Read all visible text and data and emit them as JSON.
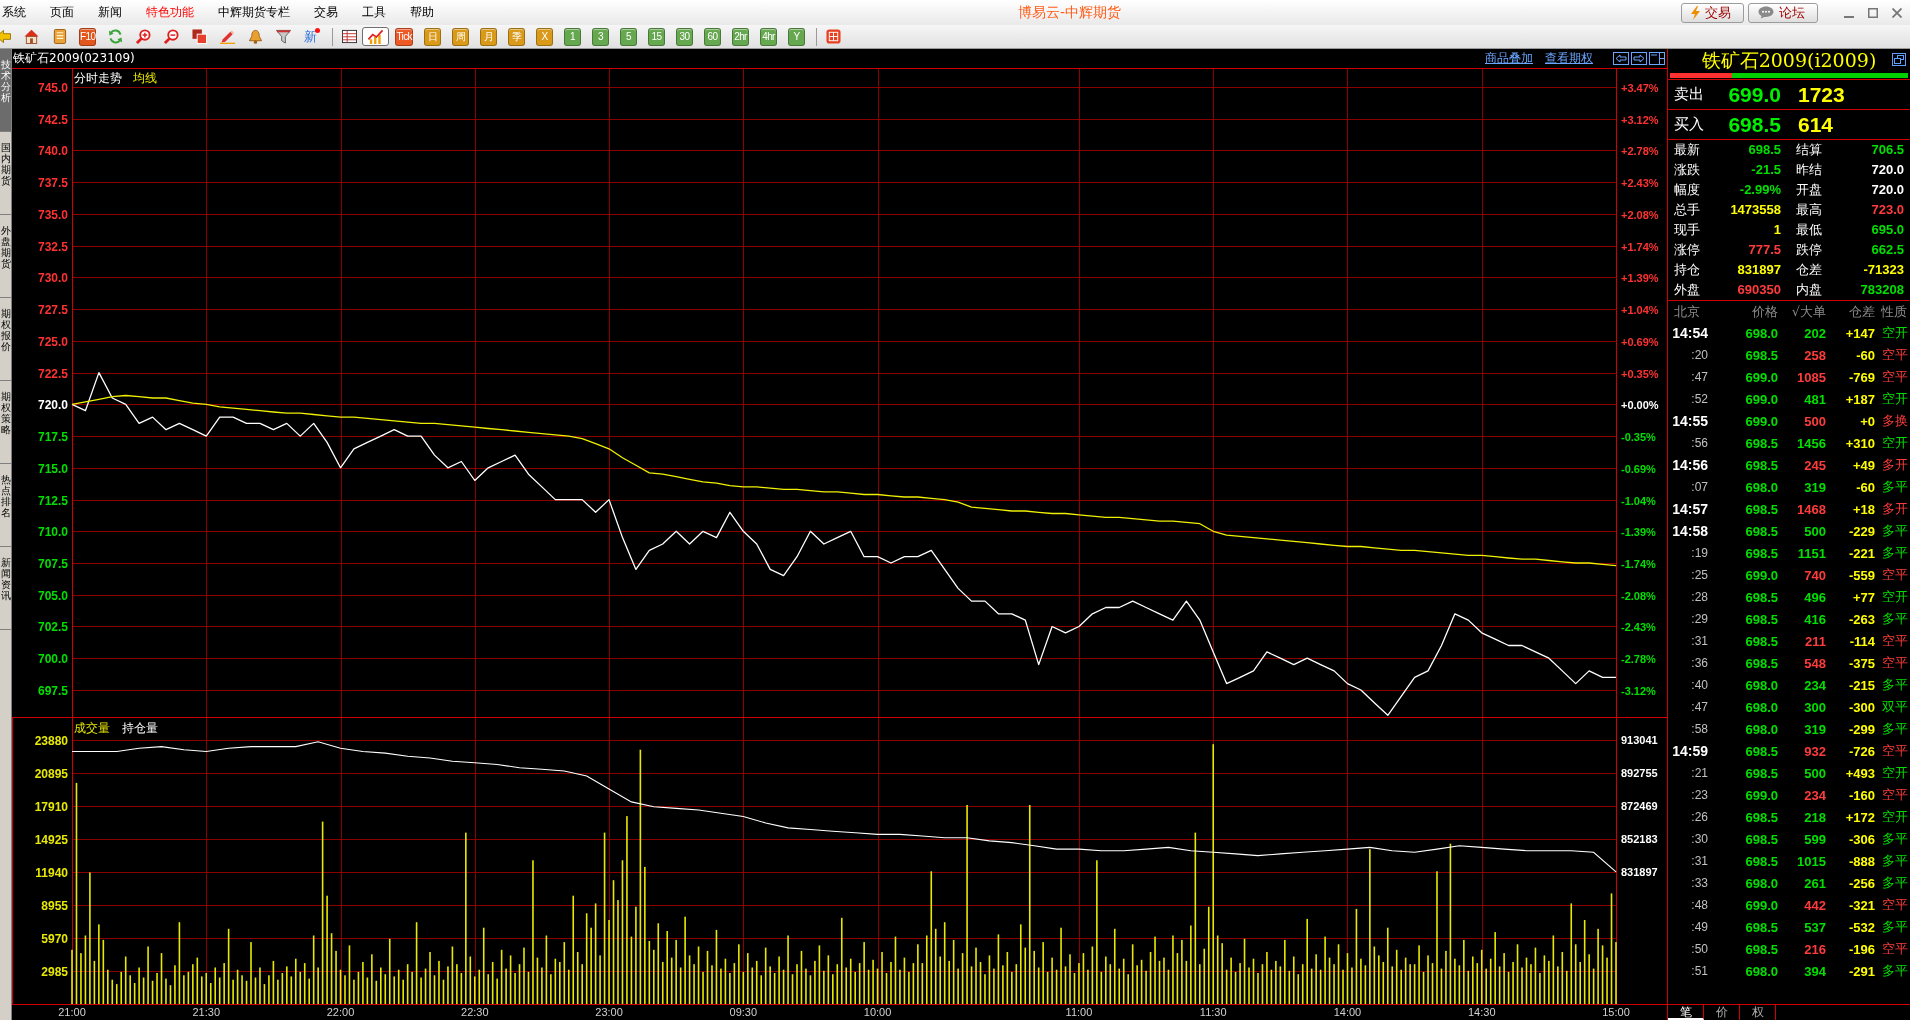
{
  "menu_bar": {
    "items": [
      {
        "label": "系统",
        "highlighted": false
      },
      {
        "label": "页面",
        "highlighted": false
      },
      {
        "label": "新闻",
        "highlighted": false
      },
      {
        "label": "特色功能",
        "highlighted": true
      },
      {
        "label": "中辉期货专栏",
        "highlighted": false
      },
      {
        "label": "交易",
        "highlighted": false
      },
      {
        "label": "工具",
        "highlighted": false
      },
      {
        "label": "帮助",
        "highlighted": false
      }
    ],
    "title": "博易云-中辉期货",
    "buttons": [
      {
        "kind": "trade",
        "label": "交易"
      },
      {
        "kind": "forum",
        "label": "论坛"
      }
    ]
  },
  "toolbar": {
    "items": [
      {
        "kind": "icon",
        "selected": false
      },
      {
        "kind": "icon",
        "selected": false
      },
      {
        "kind": "icon",
        "selected": false
      },
      {
        "kind": "tile",
        "label": "F10",
        "color": "#e2571e",
        "selected": false
      },
      {
        "kind": "icon",
        "selected": false
      },
      {
        "kind": "icon",
        "selected": false
      },
      {
        "kind": "icon",
        "selected": false
      },
      {
        "kind": "icon",
        "selected": false
      },
      {
        "kind": "icon",
        "selected": false
      },
      {
        "kind": "icon",
        "selected": false
      },
      {
        "kind": "icon",
        "selected": false
      },
      {
        "kind": "text",
        "label": "新",
        "selected": false
      },
      {
        "kind": "separator"
      },
      {
        "kind": "icon",
        "selected": false
      },
      {
        "kind": "icon",
        "selected": true
      },
      {
        "kind": "tile",
        "label": "Tick",
        "color": "#ee5a26",
        "selected": false
      },
      {
        "kind": "tile",
        "label": "日",
        "color": "#d99a1a",
        "selected": false
      },
      {
        "kind": "tile",
        "label": "周",
        "color": "#d99a1a",
        "selected": false
      },
      {
        "kind": "tile",
        "label": "月",
        "color": "#d99a1a",
        "selected": false
      },
      {
        "kind": "tile",
        "label": "季",
        "color": "#d99a1a",
        "selected": false
      },
      {
        "kind": "tile",
        "label": "X",
        "color": "#d99a1a",
        "selected": false
      },
      {
        "kind": "tile",
        "label": "1",
        "color": "#66a850",
        "selected": false
      },
      {
        "kind": "tile",
        "label": "3",
        "color": "#66a850",
        "selected": false
      },
      {
        "kind": "tile",
        "label": "5",
        "color": "#66a850",
        "selected": false
      },
      {
        "kind": "tile",
        "label": "15",
        "color": "#66a850",
        "selected": false
      },
      {
        "kind": "tile",
        "label": "30",
        "color": "#66a850",
        "selected": false
      },
      {
        "kind": "tile",
        "label": "60",
        "color": "#66a850",
        "selected": false
      },
      {
        "kind": "tile",
        "label": "2hr",
        "color": "#66a850",
        "selected": false
      },
      {
        "kind": "tile",
        "label": "4hr",
        "color": "#66a850",
        "selected": false
      },
      {
        "kind": "tile",
        "label": "Y",
        "color": "#66a850",
        "selected": false
      },
      {
        "kind": "separator"
      },
      {
        "kind": "icon",
        "selected": false
      }
    ]
  },
  "side_tabs": [
    {
      "label": "技术分析",
      "selected": true
    },
    {
      "label": "国内期货",
      "selected": false
    },
    {
      "label": "外盘期货",
      "selected": false
    },
    {
      "label": "期权报价",
      "selected": false
    },
    {
      "label": "期权策略",
      "selected": false
    },
    {
      "label": "热点排名",
      "selected": false
    },
    {
      "label": "新闻资讯",
      "selected": false
    }
  ],
  "chart_header": {
    "title": "铁矿石2009(023109)",
    "links": [
      "商品叠加",
      "查看期权"
    ]
  },
  "price_chart": {
    "percent_labels": [
      {
        "label": "+3.47%",
        "color": "#ff3232"
      },
      {
        "label": "+3.12%",
        "color": "#ff3232"
      },
      {
        "label": "+2.78%",
        "color": "#ff3232"
      },
      {
        "label": "+2.43%",
        "color": "#ff3232"
      },
      {
        "label": "+2.08%",
        "color": "#ff3232"
      },
      {
        "label": "+1.74%",
        "color": "#ff3232"
      },
      {
        "label": "+1.39%",
        "color": "#ff3232"
      },
      {
        "label": "+1.04%",
        "color": "#ff3232"
      },
      {
        "label": "+0.69%",
        "color": "#ff3232"
      },
      {
        "label": "+0.35%",
        "color": "#ff3232"
      },
      {
        "label": "+0.00%",
        "color": "#ffffff"
      },
      {
        "label": "-0.35%",
        "color": "#00e000"
      },
      {
        "label": "-0.69%",
        "color": "#00e000"
      },
      {
        "label": "-1.04%",
        "color": "#00e000"
      },
      {
        "label": "-1.39%",
        "color": "#00e000"
      },
      {
        "label": "-1.74%",
        "color": "#00e000"
      },
      {
        "label": "-2.08%",
        "color": "#00e000"
      },
      {
        "label": "-2.43%",
        "color": "#00e000"
      },
      {
        "label": "-2.78%",
        "color": "#00e000"
      },
      {
        "label": "-3.12%",
        "color": "#00e000"
      }
    ],
    "chart_data": {
      "type": "line",
      "grid": true,
      "ylim": [
        695.37,
        746.42
      ],
      "yticks": [
        {
          "value": 745,
          "label": "745.0"
        },
        {
          "value": 742.5,
          "label": "742.5"
        },
        {
          "value": 740,
          "label": "740.0"
        },
        {
          "value": 737.5,
          "label": "737.5"
        },
        {
          "value": 735,
          "label": "735.0"
        },
        {
          "value": 732.5,
          "label": "732.5"
        },
        {
          "value": 730,
          "label": "730.0"
        },
        {
          "value": 727.5,
          "label": "727.5"
        },
        {
          "value": 725,
          "label": "725.0"
        },
        {
          "value": 722.5,
          "label": "722.5"
        },
        {
          "value": 720,
          "label": "720.0"
        },
        {
          "value": 717.5,
          "label": "717.5"
        },
        {
          "value": 715,
          "label": "715.0"
        },
        {
          "value": 712.5,
          "label": "712.5"
        },
        {
          "value": 710,
          "label": "710.0"
        },
        {
          "value": 707.5,
          "label": "707.5"
        },
        {
          "value": 705,
          "label": "705.0"
        },
        {
          "value": 702.5,
          "label": "702.5"
        },
        {
          "value": 700,
          "label": "700.0"
        },
        {
          "value": 697.5,
          "label": "697.5"
        }
      ],
      "series": [
        {
          "name": "分时走势",
          "color": "#ffffff",
          "values": [
            720.0,
            719.5,
            722.5,
            720.5,
            720.0,
            718.5,
            719.0,
            718.0,
            718.5,
            718.0,
            717.5,
            719.0,
            719.0,
            718.5,
            718.5,
            718.0,
            718.5,
            717.5,
            718.5,
            717.0,
            715.0,
            716.5,
            717.0,
            717.5,
            718.0,
            717.5,
            717.5,
            716.0,
            715.0,
            715.5,
            714.0,
            715.0,
            715.5,
            716.0,
            714.5,
            713.5,
            712.5,
            712.5,
            712.5,
            711.5,
            712.5,
            709.5,
            707.0,
            708.5,
            709.0,
            710.0,
            709.0,
            710.0,
            709.5,
            711.5,
            710.0,
            709.0,
            707.0,
            706.5,
            708.0,
            710.0,
            709.0,
            709.5,
            710.0,
            708.0,
            708.0,
            707.5,
            708.0,
            708.0,
            708.5,
            707.0,
            705.5,
            704.5,
            704.5,
            703.5,
            703.5,
            703.0,
            699.5,
            702.5,
            702.0,
            702.5,
            703.5,
            704.0,
            704.0,
            704.5,
            704.0,
            703.5,
            703.0,
            704.5,
            703.0,
            700.5,
            698.0,
            698.5,
            699.0,
            700.5,
            700.0,
            699.5,
            700.0,
            699.5,
            699.0,
            698.0,
            697.5,
            696.5,
            695.5,
            697.0,
            698.5,
            699.0,
            701.0,
            703.5,
            703.0,
            702.0,
            701.5,
            701.0,
            701.0,
            700.5,
            700.0,
            699.0,
            698.0,
            699.0,
            698.5,
            698.5
          ]
        },
        {
          "name": "均线",
          "color": "#f0f000",
          "values": [
            720.0,
            720.2,
            720.4,
            720.6,
            720.7,
            720.6,
            720.5,
            720.5,
            720.3,
            720.1,
            720.0,
            719.8,
            719.7,
            719.6,
            719.5,
            719.4,
            719.3,
            719.3,
            719.2,
            719.1,
            719.0,
            719.0,
            718.9,
            718.8,
            718.7,
            718.6,
            718.5,
            718.5,
            718.4,
            718.3,
            718.2,
            718.1,
            718.0,
            717.9,
            717.8,
            717.7,
            717.6,
            717.5,
            717.3,
            716.9,
            716.5,
            715.8,
            715.2,
            714.6,
            714.5,
            714.3,
            714.1,
            713.9,
            713.8,
            713.6,
            713.5,
            713.5,
            713.4,
            713.3,
            713.3,
            713.2,
            713.1,
            713.1,
            713.0,
            712.9,
            712.9,
            712.8,
            712.7,
            712.7,
            712.6,
            712.5,
            712.3,
            711.9,
            711.8,
            711.7,
            711.6,
            711.6,
            711.5,
            711.4,
            711.4,
            711.3,
            711.2,
            711.1,
            711.1,
            711.0,
            710.9,
            710.8,
            710.8,
            710.7,
            710.6,
            710.0,
            709.7,
            709.6,
            709.5,
            709.4,
            709.3,
            709.2,
            709.1,
            709.0,
            708.9,
            708.8,
            708.8,
            708.7,
            708.6,
            708.5,
            708.5,
            708.4,
            708.3,
            708.2,
            708.1,
            708.1,
            708.0,
            707.9,
            707.8,
            707.8,
            707.7,
            707.6,
            707.5,
            707.5,
            707.4,
            707.3
          ]
        }
      ]
    }
  },
  "volume_chart": {
    "chart_data": {
      "type": "bar",
      "grid": true,
      "ylim": [
        0,
        25870
      ],
      "yticks": [
        2985,
        5970,
        8955,
        11940,
        14925,
        17910,
        20895,
        23880
      ],
      "categories": [
        "21:00",
        null,
        null,
        null,
        null,
        null,
        null,
        null,
        null,
        null,
        null,
        null,
        null,
        null,
        null,
        null,
        null,
        null,
        null,
        null,
        null,
        null,
        null,
        null,
        null,
        null,
        null,
        null,
        null,
        null,
        "21:30",
        null,
        null,
        null,
        null,
        null,
        null,
        null,
        null,
        null,
        null,
        null,
        null,
        null,
        null,
        null,
        null,
        null,
        null,
        null,
        null,
        null,
        null,
        null,
        null,
        null,
        null,
        null,
        null,
        null,
        "22:00",
        null,
        null,
        null,
        null,
        null,
        null,
        null,
        null,
        null,
        null,
        null,
        null,
        null,
        null,
        null,
        null,
        null,
        null,
        null,
        null,
        null,
        null,
        null,
        null,
        null,
        null,
        null,
        null,
        null,
        "22:30",
        null,
        null,
        null,
        null,
        null,
        null,
        null,
        null,
        null,
        null,
        null,
        null,
        null,
        null,
        null,
        null,
        null,
        null,
        null,
        null,
        null,
        null,
        null,
        null,
        null,
        null,
        null,
        null,
        null,
        "23:00",
        null,
        null,
        null,
        null,
        null,
        null,
        null,
        null,
        null,
        null,
        null,
        null,
        null,
        null,
        null,
        null,
        null,
        null,
        null,
        null,
        null,
        null,
        null,
        null,
        null,
        null,
        null,
        null,
        null,
        "09:30",
        null,
        null,
        null,
        null,
        null,
        null,
        null,
        null,
        null,
        null,
        null,
        null,
        null,
        null,
        null,
        null,
        null,
        null,
        null,
        null,
        null,
        null,
        null,
        null,
        null,
        null,
        null,
        null,
        null,
        "10:00",
        null,
        null,
        null,
        null,
        null,
        null,
        null,
        null,
        null,
        null,
        null,
        null,
        null,
        null,
        null,
        null,
        null,
        null,
        null,
        null,
        null,
        null,
        null,
        null,
        null,
        null,
        null,
        null,
        null,
        null,
        null,
        null,
        null,
        null,
        null,
        null,
        null,
        null,
        null,
        null,
        null,
        null,
        null,
        null,
        "11:00",
        null,
        null,
        null,
        null,
        null,
        null,
        null,
        null,
        null,
        null,
        null,
        null,
        null,
        null,
        null,
        null,
        null,
        null,
        null,
        null,
        null,
        null,
        null,
        null,
        null,
        null,
        null,
        null,
        null,
        "11:30",
        null,
        null,
        null,
        null,
        null,
        null,
        null,
        null,
        null,
        null,
        null,
        null,
        null,
        null,
        null,
        null,
        null,
        null,
        null,
        null,
        null,
        null,
        null,
        null,
        null,
        null,
        null,
        null,
        null,
        "14:00",
        null,
        null,
        null,
        null,
        null,
        null,
        null,
        null,
        null,
        null,
        null,
        null,
        null,
        null,
        null,
        null,
        null,
        null,
        null,
        null,
        null,
        null,
        null,
        null,
        null,
        null,
        null,
        null,
        null,
        "14:30",
        null,
        null,
        null,
        null,
        null,
        null,
        null,
        null,
        null,
        null,
        null,
        null,
        null,
        null,
        null,
        null,
        null,
        null,
        null,
        null,
        null,
        null,
        null,
        null,
        null,
        null,
        null,
        null,
        null,
        "15:00"
      ],
      "series": [
        {
          "name": "成交量",
          "color": "#e8e800",
          "values": [
            4900,
            20000,
            4600,
            6200,
            11900,
            3900,
            7200,
            5800,
            3100,
            2200,
            1800,
            2900,
            4300,
            2600,
            1900,
            3300,
            2400,
            5200,
            2100,
            2800,
            4600,
            2300,
            1700,
            3500,
            7400,
            2600,
            2900,
            3600,
            4200,
            2500,
            2800,
            1900,
            3300,
            2400,
            3700,
            6800,
            2200,
            3100,
            2600,
            2100,
            5600,
            2400,
            3300,
            1800,
            2600,
            3900,
            2200,
            2800,
            3400,
            2500,
            4100,
            2900,
            3700,
            2300,
            6200,
            3300,
            16500,
            9800,
            6400,
            4800,
            3100,
            2600,
            5300,
            2200,
            2900,
            3800,
            2400,
            4500,
            2100,
            3300,
            2700,
            5900,
            2500,
            3100,
            2200,
            3600,
            2900,
            7400,
            2400,
            3200,
            4700,
            2600,
            3900,
            2200,
            3400,
            5200,
            3600,
            2800,
            15500,
            4300,
            2500,
            3100,
            6900,
            2700,
            3800,
            2300,
            4900,
            3200,
            4400,
            2800,
            3600,
            5100,
            2900,
            13000,
            4200,
            3300,
            6200,
            2700,
            4100,
            3800,
            5600,
            3100,
            9800,
            4700,
            3600,
            8200,
            6900,
            9100,
            4400,
            15500,
            7600,
            11200,
            9400,
            13000,
            17000,
            6100,
            8800,
            23000,
            12400,
            5700,
            4900,
            7300,
            3800,
            6600,
            4200,
            5800,
            3300,
            7900,
            4400,
            3600,
            5200,
            2900,
            4800,
            3500,
            6700,
            3200,
            4100,
            2800,
            3700,
            5400,
            2900,
            4600,
            3300,
            3900,
            2600,
            5100,
            3400,
            2800,
            4300,
            3100,
            6200,
            2700,
            3600,
            4800,
            3200,
            2600,
            3900,
            5300,
            3000,
            4400,
            2700,
            3600,
            7800,
            3300,
            4100,
            2900,
            3700,
            5600,
            3100,
            4000,
            3200,
            4700,
            2800,
            3800,
            6100,
            3100,
            4200,
            2900,
            3700,
            5400,
            3700,
            6200,
            12000,
            6800,
            4300,
            7400,
            3900,
            5800,
            3200,
            4600,
            18000,
            3400,
            5100,
            3800,
            2700,
            4400,
            3200,
            6300,
            3500,
            4700,
            2900,
            3600,
            7200,
            5100,
            18000,
            4800,
            3300,
            5600,
            2900,
            4200,
            3100,
            6900,
            3400,
            4500,
            2800,
            3700,
            4600,
            3100,
            5200,
            13000,
            2900,
            4300,
            3600,
            6800,
            3200,
            4100,
            2700,
            5400,
            3500,
            4000,
            3000,
            4700,
            6100,
            3900,
            4200,
            3100,
            6200,
            4600,
            5800,
            3900,
            7100,
            15500,
            3600,
            5000,
            8800,
            23500,
            6200,
            5500,
            3100,
            4200,
            2900,
            3700,
            5900,
            3300,
            4100,
            2800,
            3600,
            4700,
            3100,
            3900,
            3400,
            5800,
            3000,
            4300,
            2700,
            3600,
            7700,
            3200,
            4500,
            3100,
            6100,
            4200,
            3600,
            5400,
            3100,
            4600,
            3300,
            8600,
            4100,
            3500,
            14000,
            5200,
            4400,
            3800,
            6900,
            3400,
            4900,
            3100,
            4200,
            3600,
            3600,
            5300,
            2900,
            4400,
            3700,
            12000,
            3200,
            4800,
            14500,
            4100,
            3500,
            5800,
            3000,
            4300,
            3700,
            4900,
            3200,
            4100,
            6500,
            3400,
            4600,
            2900,
            3800,
            5400,
            3300,
            4200,
            3600,
            5100,
            2800,
            4400,
            3900,
            6200,
            3400,
            4700,
            3000,
            9100,
            5400,
            3800,
            7600,
            4500,
            3200,
            6800,
            5300,
            4200,
            10000,
            5600
          ]
        }
      ]
    },
    "open_interest": {
      "chart_data": {
        "type": "line",
        "ylim": [
          831897,
          913041
        ],
        "yticks": [
          831897,
          852183,
          872469,
          892755,
          913041
        ],
        "series": [
          {
            "name": "持仓量",
            "color": "#ffffff",
            "values": [
              906000,
              906000,
              906000,
              908000,
              909000,
              907000,
              906000,
              908000,
              909000,
              909000,
              909000,
              912000,
              908000,
              906000,
              905000,
              903000,
              902000,
              900000,
              899000,
              898000,
              896000,
              895000,
              894000,
              891000,
              883000,
              875000,
              872000,
              871000,
              870000,
              868000,
              866000,
              862000,
              859000,
              858000,
              857000,
              856000,
              855000,
              855000,
              854000,
              853000,
              853000,
              851000,
              850000,
              848000,
              846000,
              846000,
              845000,
              845000,
              846000,
              847000,
              845000,
              844000,
              843000,
              842000,
              843000,
              844000,
              845000,
              846000,
              847000,
              845000,
              844000,
              846000,
              848000,
              847000,
              846000,
              845000,
              845000,
              845000,
              844000,
              832000
            ]
          }
        ]
      }
    }
  },
  "quote": {
    "title": "铁矿石2009(i2009)",
    "level": 0.26,
    "sell": {
      "label": "卖出",
      "price": "699.0",
      "volume": "1723"
    },
    "buy": {
      "label": "买入",
      "price": "698.5",
      "volume": "614"
    },
    "stats": [
      {
        "label": "最新",
        "value": "698.5",
        "color": "#00e000"
      },
      {
        "label": "结算",
        "value": "706.5",
        "color": "#00e000"
      },
      {
        "label": "涨跌",
        "value": "-21.5",
        "color": "#00e000"
      },
      {
        "label": "昨结",
        "value": "720.0",
        "color": "#ffffff"
      },
      {
        "label": "幅度",
        "value": "-2.99%",
        "color": "#00e000"
      },
      {
        "label": "开盘",
        "value": "720.0",
        "color": "#ffffff"
      },
      {
        "label": "总手",
        "value": "1473558",
        "color": "#ffff00"
      },
      {
        "label": "最高",
        "value": "723.0",
        "color": "#ff3c3c"
      },
      {
        "label": "现手",
        "value": "1",
        "color": "#ffff00"
      },
      {
        "label": "最低",
        "value": "695.0",
        "color": "#00e000"
      },
      {
        "label": "涨停",
        "value": "777.5",
        "color": "#ff3c3c"
      },
      {
        "label": "跌停",
        "value": "662.5",
        "color": "#00e000"
      },
      {
        "label": "持仓",
        "value": "831897",
        "color": "#ffff00"
      },
      {
        "label": "仓差",
        "value": "-71323",
        "color": "#ffff00"
      },
      {
        "label": "外盘",
        "value": "690350",
        "color": "#ff3c3c"
      },
      {
        "label": "内盘",
        "value": "783208",
        "color": "#00e000"
      }
    ],
    "trades": {
      "columns": [
        "北京",
        "价格",
        "√大单",
        "仓差",
        "性质"
      ],
      "rows": [
        {
          "time": "14:54",
          "kind": "minute",
          "price": "698.0",
          "volume": "202",
          "change": "+147",
          "nature": "空开",
          "color": "#00e000"
        },
        {
          "time": ":20",
          "kind": "second",
          "price": "698.5",
          "volume": "258",
          "change": "-60",
          "nature": "空平",
          "color": "#ff3c3c"
        },
        {
          "time": ":47",
          "kind": "second",
          "price": "699.0",
          "volume": "1085",
          "change": "-769",
          "nature": "空平",
          "color": "#ff3c3c"
        },
        {
          "time": ":52",
          "kind": "second",
          "price": "699.0",
          "volume": "481",
          "change": "+187",
          "nature": "空开",
          "color": "#00e000"
        },
        {
          "time": "14:55",
          "kind": "minute",
          "price": "699.0",
          "volume": "500",
          "change": "+0",
          "nature": "多换",
          "color": "#ff3c3c"
        },
        {
          "time": ":56",
          "kind": "second",
          "price": "698.5",
          "volume": "1456",
          "change": "+310",
          "nature": "空开",
          "color": "#00e000"
        },
        {
          "time": "14:56",
          "kind": "minute",
          "price": "698.5",
          "volume": "245",
          "change": "+49",
          "nature": "多开",
          "color": "#ff3c3c"
        },
        {
          "time": ":07",
          "kind": "second",
          "price": "698.0",
          "volume": "319",
          "change": "-60",
          "nature": "多平",
          "color": "#00e000"
        },
        {
          "time": "14:57",
          "kind": "minute",
          "price": "698.5",
          "volume": "1468",
          "change": "+18",
          "nature": "多开",
          "color": "#ff3c3c"
        },
        {
          "time": "14:58",
          "kind": "minute",
          "price": "698.5",
          "volume": "500",
          "change": "-229",
          "nature": "多平",
          "color": "#00e000"
        },
        {
          "time": ":19",
          "kind": "second",
          "price": "698.5",
          "volume": "1151",
          "change": "-221",
          "nature": "多平",
          "color": "#00e000"
        },
        {
          "time": ":25",
          "kind": "second",
          "price": "699.0",
          "volume": "740",
          "change": "-559",
          "nature": "空平",
          "color": "#ff3c3c"
        },
        {
          "time": ":28",
          "kind": "second",
          "price": "698.5",
          "volume": "496",
          "change": "+77",
          "nature": "空开",
          "color": "#00e000"
        },
        {
          "time": ":29",
          "kind": "second",
          "price": "698.5",
          "volume": "416",
          "change": "-263",
          "nature": "多平",
          "color": "#00e000"
        },
        {
          "time": ":31",
          "kind": "second",
          "price": "698.5",
          "volume": "211",
          "change": "-114",
          "nature": "空平",
          "color": "#ff3c3c"
        },
        {
          "time": ":36",
          "kind": "second",
          "price": "698.5",
          "volume": "548",
          "change": "-375",
          "nature": "空平",
          "color": "#ff3c3c"
        },
        {
          "time": ":40",
          "kind": "second",
          "price": "698.0",
          "volume": "234",
          "change": "-215",
          "nature": "多平",
          "color": "#00e000"
        },
        {
          "time": ":47",
          "kind": "second",
          "price": "698.0",
          "volume": "300",
          "change": "-300",
          "nature": "双平",
          "color": "#00e000"
        },
        {
          "time": ":58",
          "kind": "second",
          "price": "698.0",
          "volume": "319",
          "change": "-299",
          "nature": "多平",
          "color": "#00e000"
        },
        {
          "time": "14:59",
          "kind": "minute",
          "price": "698.5",
          "volume": "932",
          "change": "-726",
          "nature": "空平",
          "color": "#ff3c3c"
        },
        {
          "time": ":21",
          "kind": "second",
          "price": "698.5",
          "volume": "500",
          "change": "+493",
          "nature": "空开",
          "color": "#00e000"
        },
        {
          "time": ":23",
          "kind": "second",
          "price": "699.0",
          "volume": "234",
          "change": "-160",
          "nature": "空平",
          "color": "#ff3c3c"
        },
        {
          "time": ":26",
          "kind": "second",
          "price": "698.5",
          "volume": "218",
          "change": "+172",
          "nature": "空开",
          "color": "#00e000"
        },
        {
          "time": ":30",
          "kind": "second",
          "price": "698.5",
          "volume": "599",
          "change": "-306",
          "nature": "多平",
          "color": "#00e000"
        },
        {
          "time": ":31",
          "kind": "second",
          "price": "698.5",
          "volume": "1015",
          "change": "-888",
          "nature": "多平",
          "color": "#00e000"
        },
        {
          "time": ":33",
          "kind": "second",
          "price": "698.0",
          "volume": "261",
          "change": "-256",
          "nature": "多平",
          "color": "#00e000"
        },
        {
          "time": ":48",
          "kind": "second",
          "price": "699.0",
          "volume": "442",
          "change": "-321",
          "nature": "空平",
          "color": "#ff3c3c"
        },
        {
          "time": ":49",
          "kind": "second",
          "price": "698.5",
          "volume": "537",
          "change": "-532",
          "nature": "多平",
          "color": "#00e000"
        },
        {
          "time": ":50",
          "kind": "second",
          "price": "698.5",
          "volume": "216",
          "change": "-196",
          "nature": "空平",
          "color": "#ff3c3c"
        },
        {
          "time": ":51",
          "kind": "second",
          "price": "698.0",
          "volume": "394",
          "change": "-291",
          "nature": "多平",
          "color": "#00e000"
        }
      ]
    },
    "tabs": [
      {
        "label": "笔",
        "selected": true
      },
      {
        "label": "价",
        "selected": false
      },
      {
        "label": "权",
        "selected": false
      }
    ]
  }
}
